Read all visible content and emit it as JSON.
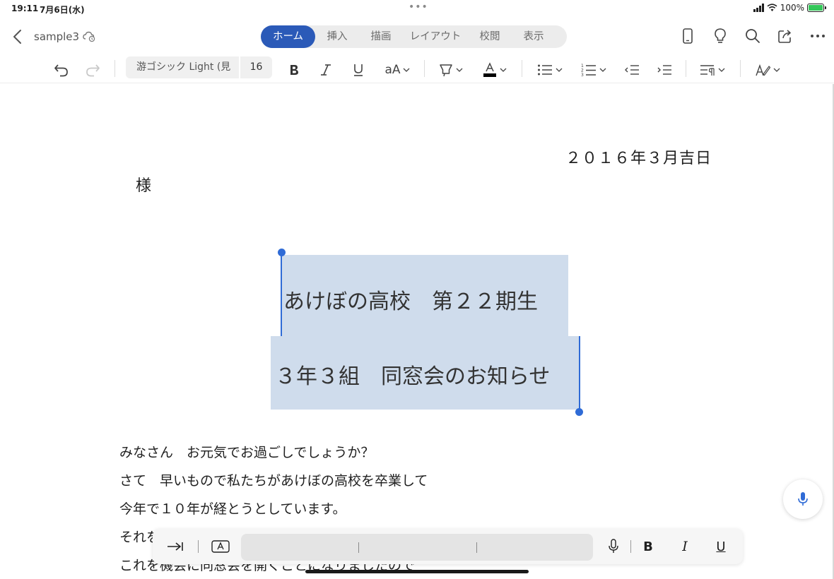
{
  "status_bar": {
    "time": "19:11",
    "date": "7月6日(水)",
    "battery": "100%"
  },
  "titlebar": {
    "doc_name": "sample3"
  },
  "tabs": [
    {
      "label": "ホーム",
      "active": true
    },
    {
      "label": "挿入",
      "active": false
    },
    {
      "label": "描画",
      "active": false
    },
    {
      "label": "レイアウト",
      "active": false
    },
    {
      "label": "校閲",
      "active": false
    },
    {
      "label": "表示",
      "active": false
    }
  ],
  "ribbon": {
    "font_name": "游ゴシック Light (見",
    "font_size": "16",
    "size_toggle_label": "aA"
  },
  "document": {
    "date_line": "２０１６年３月吉日",
    "recipient": "様",
    "heading_1": "あけぼの高校　第２２期生",
    "heading_2": "３年３組　同窓会のお知らせ",
    "body_lines": [
      "みなさん　お元気でお過ごしでしょうか？",
      "さて　早いもので私たちがあけぼの高校を卒業して",
      "今年で１０年が経とうとしています。",
      "それを",
      "これを機会に同窓会を開くことになりましたので"
    ]
  },
  "keyboard_bar": {
    "bold_label": "B",
    "italic_label": "I",
    "underline_label": "U"
  },
  "colors": {
    "accent": "#2b5ab8",
    "selection": "#cfdcec",
    "handle": "#2f6bd6"
  }
}
